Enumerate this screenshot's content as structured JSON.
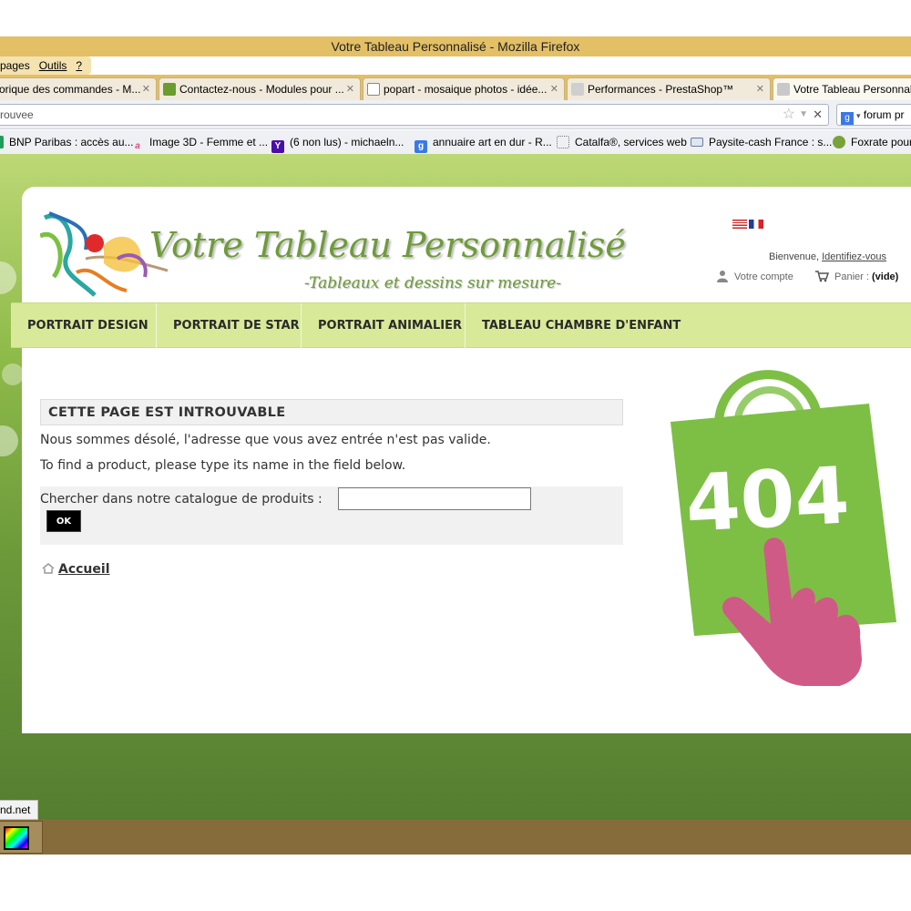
{
  "window": {
    "title": "Votre Tableau Personnalisé - Mozilla Firefox"
  },
  "menubar": {
    "items": [
      "pages",
      "Outils",
      "?"
    ]
  },
  "tabs": [
    {
      "label": "orique des commandes - M...",
      "favicon": "generic-page-icon"
    },
    {
      "label": "Contactez-nous - Modules pour ...",
      "favicon": "prestashop-icon"
    },
    {
      "label": "popart - mosaique photos - idée...",
      "favicon": "picture-icon"
    },
    {
      "label": "Performances - PrestaShop™",
      "favicon": "prestashop-icon"
    },
    {
      "label": "Votre Tableau Personnal",
      "favicon": "painting-icon"
    }
  ],
  "navbar": {
    "url": "rouvee",
    "search_value": "forum pr"
  },
  "bookmarks": [
    {
      "label": "BNP Paribas : accès au...",
      "icon": "bnp-icon",
      "color": "#1b9e5a"
    },
    {
      "label": "Image 3D - Femme et ...",
      "icon": "a-icon",
      "color": "#e0457b"
    },
    {
      "label": "(6 non lus) - michaeln...",
      "icon": "yahoo-icon",
      "color": "#4b0fa8"
    },
    {
      "label": "annuaire art en dur - R...",
      "icon": "google-icon",
      "color": "#3b78e7"
    },
    {
      "label": "Catalfa®, services web",
      "icon": "dotted-frame-icon",
      "color": "#999999"
    },
    {
      "label": "Paysite-cash France : s...",
      "icon": "card-icon",
      "color": "#6a7f99"
    },
    {
      "label": "Foxrate pour",
      "icon": "foxrate-icon",
      "color": "#7aa23a"
    }
  ],
  "site": {
    "logo_title": "Votre Tableau Personnalisé",
    "logo_subtitle": "-Tableaux et dessins sur mesure-",
    "welcome_prefix": "Bienvenue,",
    "login_link": "Identifiez-vous",
    "account_label": "Votre compte",
    "cart_label": "Panier :",
    "cart_value": "(vide)",
    "menu": [
      "PORTRAIT DESIGN",
      "PORTRAIT DE STAR",
      "PORTRAIT ANIMALIER",
      "TABLEAU CHAMBRE D'ENFANT"
    ],
    "error_title": "CETTE PAGE EST INTROUVABLE",
    "error_msg_1": "Nous sommes désolé, l'adresse que vous avez entrée n'est pas valide.",
    "error_msg_2": "To find a product, please type its name in the field below.",
    "search_label": "Chercher dans notre catalogue de produits :",
    "search_value": "",
    "ok_label": "OK",
    "home_label": "Accueil",
    "bag_code": "404",
    "colors": {
      "accent_green": "#7dbf45",
      "menu_bg": "#d8ea99",
      "hand_pink": "#d05a86"
    }
  },
  "status": {
    "text": "nd.net"
  }
}
